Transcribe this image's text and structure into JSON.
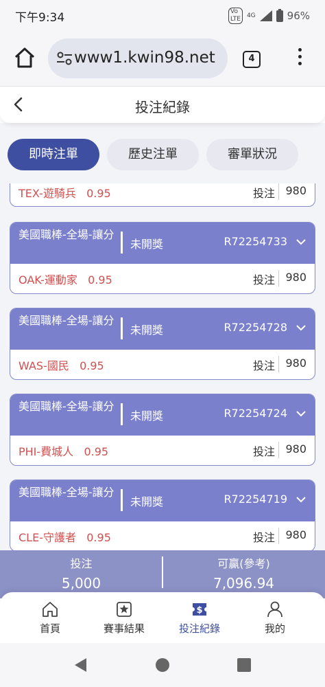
{
  "status_bar": {
    "time": "下午9:34",
    "volte": "VoLTE",
    "network": "4G",
    "battery": "96%"
  },
  "browser": {
    "url": "www1.kwin98.net",
    "tab_count": "4"
  },
  "header": {
    "title": "投注紀錄"
  },
  "tabs": [
    {
      "label": "即時注單",
      "active": true
    },
    {
      "label": "歷史注單",
      "active": false
    },
    {
      "label": "審單狀況",
      "active": false
    }
  ],
  "partial_card": {
    "pick": "TEX-遊騎兵",
    "odds": "0.95",
    "bet_label": "投注",
    "amount": "980"
  },
  "bets": [
    {
      "market": "美國職棒-全場-讓分",
      "status": "未開獎",
      "id": "R72254733",
      "pick": "OAK-運動家",
      "odds": "0.95",
      "bet_label": "投注",
      "amount": "980"
    },
    {
      "market": "美國職棒-全場-讓分",
      "status": "未開獎",
      "id": "R72254728",
      "pick": "WAS-國民",
      "odds": "0.95",
      "bet_label": "投注",
      "amount": "980"
    },
    {
      "market": "美國職棒-全場-讓分",
      "status": "未開獎",
      "id": "R72254724",
      "pick": "PHI-費城人",
      "odds": "0.95",
      "bet_label": "投注",
      "amount": "980"
    },
    {
      "market": "美國職棒-全場-讓分",
      "status": "未開獎",
      "id": "R72254719",
      "pick": "CLE-守護者",
      "odds": "0.95",
      "bet_label": "投注",
      "amount": "980"
    }
  ],
  "summary": {
    "stake_label": "投注",
    "stake_value": "5,000",
    "win_label": "可贏(參考)",
    "win_value": "7,096.94"
  },
  "bottom_nav": [
    {
      "label": "首頁",
      "icon": "home-icon"
    },
    {
      "label": "賽事結果",
      "icon": "star-badge-icon"
    },
    {
      "label": "投注紀錄",
      "icon": "dollar-ticket-icon",
      "active": true
    },
    {
      "label": "我的",
      "icon": "user-icon"
    }
  ],
  "colors": {
    "primary": "#3e4ea0",
    "card_header": "#7a80cc",
    "pick_text": "#d0504f",
    "summary_bg": "#8c91c6"
  }
}
